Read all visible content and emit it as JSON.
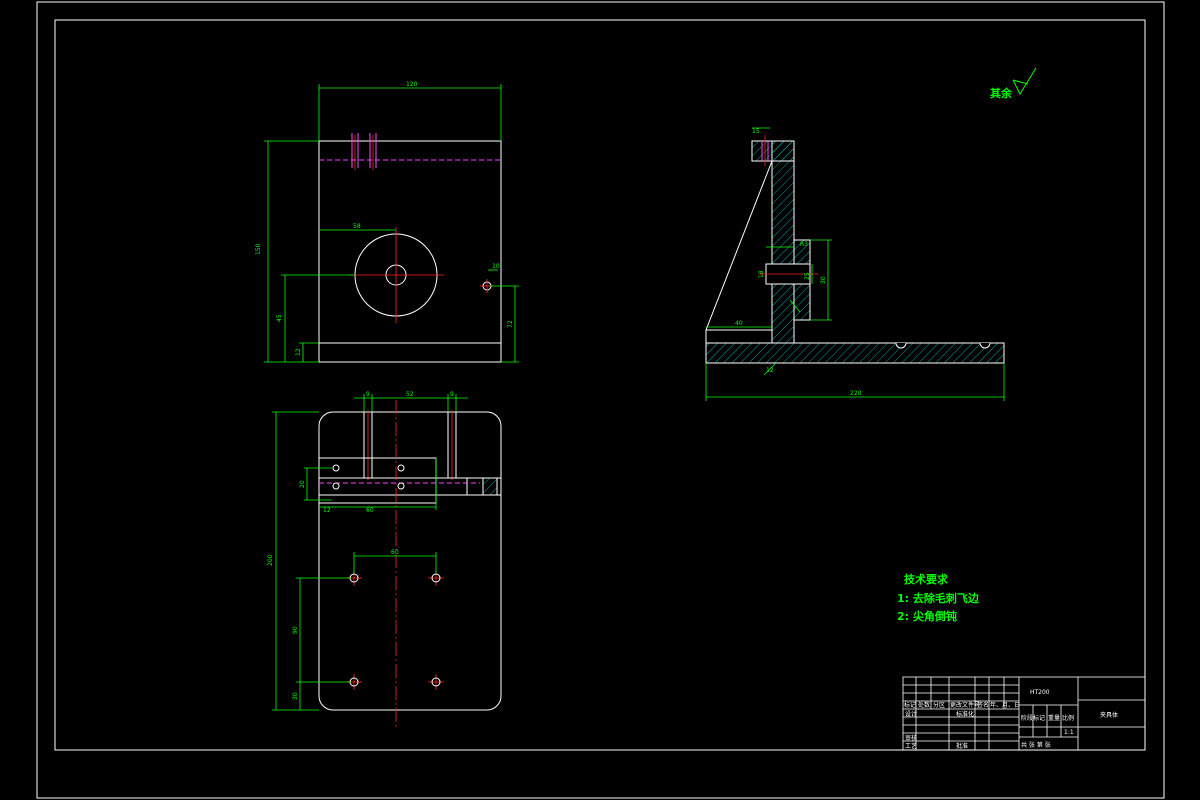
{
  "roughness_note": "其余",
  "tech_requirements": {
    "title": "技术要求",
    "items": [
      "1: 去除毛刺飞边",
      "2: 尖角倒钝"
    ]
  },
  "title_block": {
    "material": "HT200",
    "part_name": "夹具体",
    "scale_label": "比例",
    "sheet_label": "共  张  第  张",
    "header_cells": [
      "标记",
      "处数",
      "分区",
      "更改文件号",
      "签名",
      "年、月、日"
    ],
    "designer": "设计",
    "standardization": "标准化",
    "stage_label": "阶段标记",
    "weight_label": "重量",
    "scale_field": "比例",
    "checker": "审核",
    "process": "工艺",
    "approve": "批准",
    "scale_value": "1:1"
  },
  "dimensions": {
    "front_width": "120",
    "front_height": "150",
    "bore_offset": "58",
    "hole_height": "72",
    "left_height": "45",
    "base_height": "12",
    "small_hole": "10",
    "top_gap_left": "9",
    "top_mid": "52",
    "top_gap_right": "9",
    "top_total": "200",
    "hole_spacing_h": "60",
    "hole_spacing_v": "90",
    "bottom_offset": "30",
    "slot_w": "12",
    "slot_h": "20",
    "slot_l": "60",
    "side_top": "15",
    "side_fillet": "R3",
    "side_hole": "18",
    "side_left": "40",
    "side_thick": "12",
    "side_total": "220",
    "side_bore": "25",
    "side_step": "30"
  }
}
